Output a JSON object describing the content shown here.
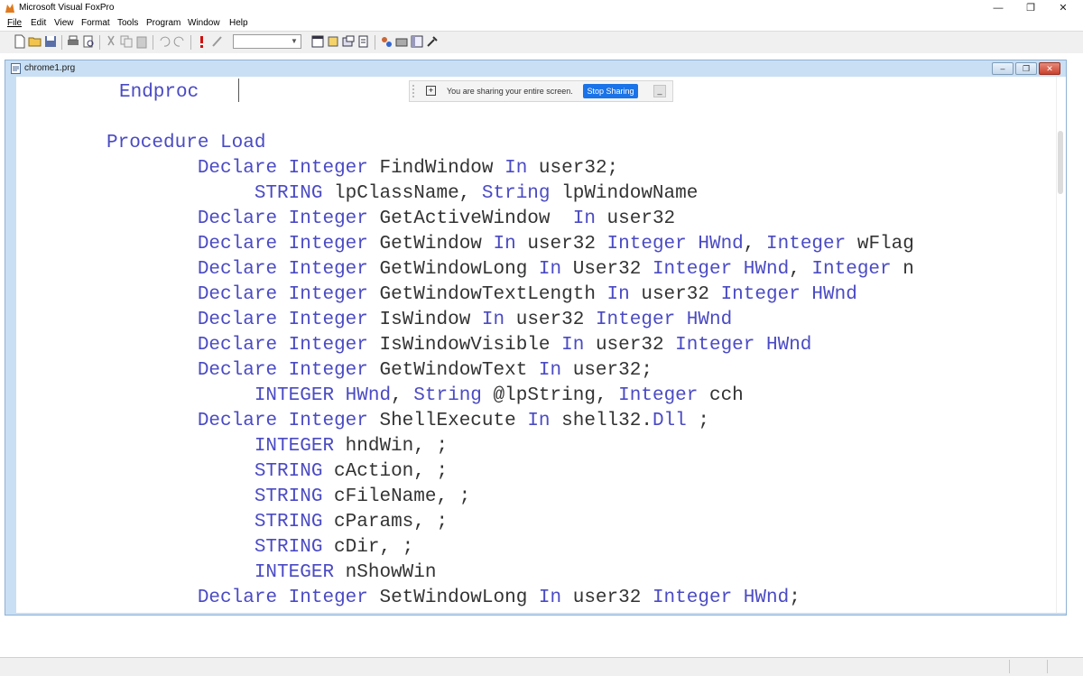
{
  "app": {
    "title": "Microsoft Visual FoxPro"
  },
  "window_controls": {
    "minimize": "—",
    "restore": "❐",
    "close": "✕"
  },
  "menu": [
    "File",
    "Edit",
    "View",
    "Format",
    "Tools",
    "Program",
    "Window",
    "Help"
  ],
  "toolbar": {
    "combo_value": ""
  },
  "editor": {
    "title": "chrome1.prg",
    "controls": {
      "minimize": "–",
      "restore": "❐",
      "close": "✕"
    },
    "lines": [
      {
        "indent": "",
        "segments": [
          [
            "kw",
            "Endproc"
          ]
        ]
      },
      {
        "indent": "",
        "segments": []
      },
      {
        "indent": "",
        "segments": [
          [
            "kw",
            "Procedure"
          ],
          [
            "t",
            " "
          ],
          [
            "kw",
            "Load"
          ]
        ]
      },
      {
        "indent": "        ",
        "segments": [
          [
            "kw",
            "Declare"
          ],
          [
            "t",
            " "
          ],
          [
            "kw",
            "Integer"
          ],
          [
            "t",
            " FindWindow "
          ],
          [
            "kw",
            "In"
          ],
          [
            "t",
            " user32;"
          ]
        ]
      },
      {
        "indent": "             ",
        "segments": [
          [
            "kw",
            "STRING"
          ],
          [
            "t",
            " lpClassName, "
          ],
          [
            "kw",
            "String"
          ],
          [
            "t",
            " lpWindowName"
          ]
        ]
      },
      {
        "indent": "        ",
        "segments": [
          [
            "kw",
            "Declare"
          ],
          [
            "t",
            " "
          ],
          [
            "kw",
            "Integer"
          ],
          [
            "t",
            " GetActiveWindow  "
          ],
          [
            "kw",
            "In"
          ],
          [
            "t",
            " user32"
          ]
        ]
      },
      {
        "indent": "        ",
        "segments": [
          [
            "kw",
            "Declare"
          ],
          [
            "t",
            " "
          ],
          [
            "kw",
            "Integer"
          ],
          [
            "t",
            " GetWindow "
          ],
          [
            "kw",
            "In"
          ],
          [
            "t",
            " user32 "
          ],
          [
            "kw",
            "Integer"
          ],
          [
            "t",
            " "
          ],
          [
            "kw",
            "HWnd"
          ],
          [
            "t",
            ", "
          ],
          [
            "kw",
            "Integer"
          ],
          [
            "t",
            " wFlag"
          ]
        ]
      },
      {
        "indent": "        ",
        "segments": [
          [
            "kw",
            "Declare"
          ],
          [
            "t",
            " "
          ],
          [
            "kw",
            "Integer"
          ],
          [
            "t",
            " GetWindowLong "
          ],
          [
            "kw",
            "In"
          ],
          [
            "t",
            " User32 "
          ],
          [
            "kw",
            "Integer"
          ],
          [
            "t",
            " "
          ],
          [
            "kw",
            "HWnd"
          ],
          [
            "t",
            ", "
          ],
          [
            "kw",
            "Integer"
          ],
          [
            "t",
            " n"
          ]
        ]
      },
      {
        "indent": "        ",
        "segments": [
          [
            "kw",
            "Declare"
          ],
          [
            "t",
            " "
          ],
          [
            "kw",
            "Integer"
          ],
          [
            "t",
            " GetWindowTextLength "
          ],
          [
            "kw",
            "In"
          ],
          [
            "t",
            " user32 "
          ],
          [
            "kw",
            "Integer"
          ],
          [
            "t",
            " "
          ],
          [
            "kw",
            "HWnd"
          ]
        ]
      },
      {
        "indent": "        ",
        "segments": [
          [
            "kw",
            "Declare"
          ],
          [
            "t",
            " "
          ],
          [
            "kw",
            "Integer"
          ],
          [
            "t",
            " IsWindow "
          ],
          [
            "kw",
            "In"
          ],
          [
            "t",
            " user32 "
          ],
          [
            "kw",
            "Integer"
          ],
          [
            "t",
            " "
          ],
          [
            "kw",
            "HWnd"
          ]
        ]
      },
      {
        "indent": "        ",
        "segments": [
          [
            "kw",
            "Declare"
          ],
          [
            "t",
            " "
          ],
          [
            "kw",
            "Integer"
          ],
          [
            "t",
            " IsWindowVisible "
          ],
          [
            "kw",
            "In"
          ],
          [
            "t",
            " user32 "
          ],
          [
            "kw",
            "Integer"
          ],
          [
            "t",
            " "
          ],
          [
            "kw",
            "HWnd"
          ]
        ]
      },
      {
        "indent": "        ",
        "segments": [
          [
            "kw",
            "Declare"
          ],
          [
            "t",
            " "
          ],
          [
            "kw",
            "Integer"
          ],
          [
            "t",
            " GetWindowText "
          ],
          [
            "kw",
            "In"
          ],
          [
            "t",
            " user32;"
          ]
        ]
      },
      {
        "indent": "             ",
        "segments": [
          [
            "kw",
            "INTEGER"
          ],
          [
            "t",
            " "
          ],
          [
            "kw",
            "HWnd"
          ],
          [
            "t",
            ", "
          ],
          [
            "kw",
            "String"
          ],
          [
            "t",
            " @lpString, "
          ],
          [
            "kw",
            "Integer"
          ],
          [
            "t",
            " cch"
          ]
        ]
      },
      {
        "indent": "        ",
        "segments": [
          [
            "kw",
            "Declare"
          ],
          [
            "t",
            " "
          ],
          [
            "kw",
            "Integer"
          ],
          [
            "t",
            " ShellExecute "
          ],
          [
            "kw",
            "In"
          ],
          [
            "t",
            " shell32."
          ],
          [
            "kw",
            "Dll"
          ],
          [
            "t",
            " ;"
          ]
        ]
      },
      {
        "indent": "             ",
        "segments": [
          [
            "kw",
            "INTEGER"
          ],
          [
            "t",
            " hndWin, ;"
          ]
        ]
      },
      {
        "indent": "             ",
        "segments": [
          [
            "kw",
            "STRING"
          ],
          [
            "t",
            " cAction, ;"
          ]
        ]
      },
      {
        "indent": "             ",
        "segments": [
          [
            "kw",
            "STRING"
          ],
          [
            "t",
            " cFileName, ;"
          ]
        ]
      },
      {
        "indent": "             ",
        "segments": [
          [
            "kw",
            "STRING"
          ],
          [
            "t",
            " cParams, ;"
          ]
        ]
      },
      {
        "indent": "             ",
        "segments": [
          [
            "kw",
            "STRING"
          ],
          [
            "t",
            " cDir, ;"
          ]
        ]
      },
      {
        "indent": "             ",
        "segments": [
          [
            "kw",
            "INTEGER"
          ],
          [
            "t",
            " nShowWin"
          ]
        ]
      },
      {
        "indent": "        ",
        "segments": [
          [
            "kw",
            "Declare"
          ],
          [
            "t",
            " "
          ],
          [
            "kw",
            "Integer"
          ],
          [
            "t",
            " SetWindowLong "
          ],
          [
            "kw",
            "In"
          ],
          [
            "t",
            " user32 "
          ],
          [
            "kw",
            "Integer"
          ],
          [
            "t",
            " "
          ],
          [
            "kw",
            "HWnd"
          ],
          [
            "t",
            ";"
          ]
        ]
      }
    ]
  },
  "share_banner": {
    "message": "You are sharing your entire screen.",
    "stop_label": "Stop Sharing",
    "minimize_label": "_"
  },
  "colors": {
    "keyword": "#4a4ac4",
    "text": "#333333",
    "stop_button": "#1a73e8"
  }
}
